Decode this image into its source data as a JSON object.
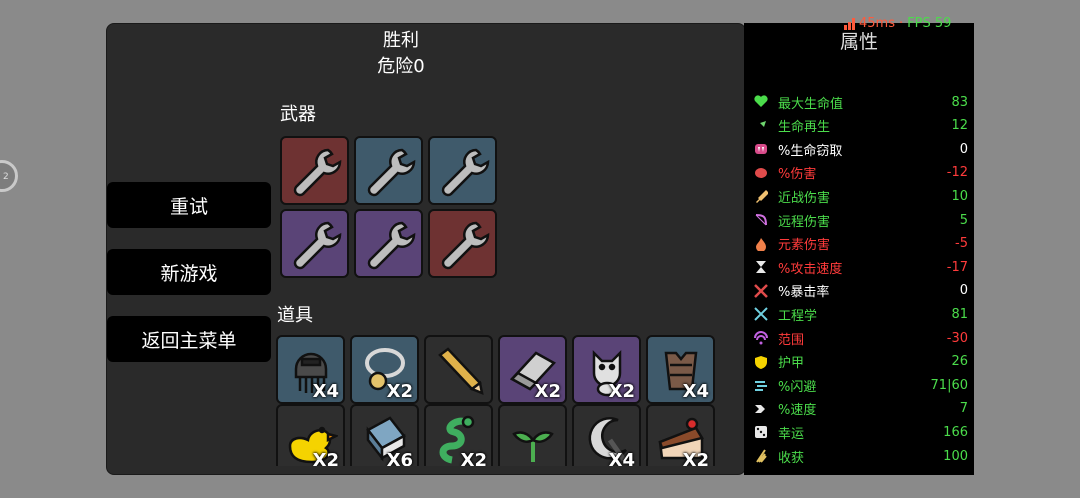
{
  "result": {
    "title": "胜利",
    "subtitle": "危险0"
  },
  "menu": {
    "retry": "重试",
    "new_game": "新游戏",
    "main_menu": "返回主菜单"
  },
  "weapons": {
    "label": "武器",
    "items": [
      {
        "icon": "wrench-icon",
        "tier_color": "#6e3232"
      },
      {
        "icon": "wrench-icon",
        "tier_color": "#3f5a6b"
      },
      {
        "icon": "wrench-icon",
        "tier_color": "#3f5a6b"
      },
      {
        "icon": "wrench-icon",
        "tier_color": "#5a4477"
      },
      {
        "icon": "wrench-icon",
        "tier_color": "#5a4477"
      },
      {
        "icon": "wrench-icon",
        "tier_color": "#6e3232"
      }
    ]
  },
  "items": {
    "label": "道具",
    "list": [
      {
        "icon": "octopus-helmet-icon",
        "qty": "X4"
      },
      {
        "icon": "amulet-icon",
        "qty": "X2"
      },
      {
        "icon": "pencil-icon",
        "qty": ""
      },
      {
        "icon": "eraser-icon",
        "qty": "X2"
      },
      {
        "icon": "cat-icon",
        "qty": "X2"
      },
      {
        "icon": "leather-vest-icon",
        "qty": "X4"
      },
      {
        "icon": "rubber-duck-icon",
        "qty": "X2"
      },
      {
        "icon": "book-icon",
        "qty": "X6"
      },
      {
        "icon": "snake-icon",
        "qty": "X2"
      },
      {
        "icon": "sprout-icon",
        "qty": ""
      },
      {
        "icon": "crescent-icon",
        "qty": "X4"
      },
      {
        "icon": "cake-icon",
        "qty": "X2"
      }
    ]
  },
  "stats": {
    "title": "属性",
    "rows": [
      {
        "icon": "heart-icon",
        "label": "最大生命值",
        "value": "83",
        "color": "green"
      },
      {
        "icon": "regen-icon",
        "label": "生命再生",
        "value": "12",
        "color": "green"
      },
      {
        "icon": "fangs-icon",
        "label": "%生命窃取",
        "value": "0",
        "color": "white"
      },
      {
        "icon": "muscle-icon",
        "label": "%伤害",
        "value": "-12",
        "color": "red"
      },
      {
        "icon": "sword-icon",
        "label": "近战伤害",
        "value": "10",
        "color": "green"
      },
      {
        "icon": "bow-icon",
        "label": "远程伤害",
        "value": "5",
        "color": "green"
      },
      {
        "icon": "flame-icon",
        "label": "元素伤害",
        "value": "-5",
        "color": "red"
      },
      {
        "icon": "hourglass-icon",
        "label": "%攻击速度",
        "value": "-17",
        "color": "red"
      },
      {
        "icon": "crit-icon",
        "label": "%暴击率",
        "value": "0",
        "color": "white"
      },
      {
        "icon": "tools-icon",
        "label": "工程学",
        "value": "81",
        "color": "green"
      },
      {
        "icon": "range-icon",
        "label": "范围",
        "value": "-30",
        "color": "red"
      },
      {
        "icon": "shield-icon",
        "label": "护甲",
        "value": "26",
        "color": "green"
      },
      {
        "icon": "dodge-icon",
        "label": "%闪避",
        "value": "71|60",
        "color": "green"
      },
      {
        "icon": "speed-icon",
        "label": "%速度",
        "value": "7",
        "color": "green"
      },
      {
        "icon": "dice-icon",
        "label": "幸运",
        "value": "166",
        "color": "green"
      },
      {
        "icon": "harvest-icon",
        "label": "收获",
        "value": "100",
        "color": "green"
      }
    ]
  },
  "perf": {
    "ping": "45ms",
    "separator": "·",
    "fps": "FPS 59"
  }
}
